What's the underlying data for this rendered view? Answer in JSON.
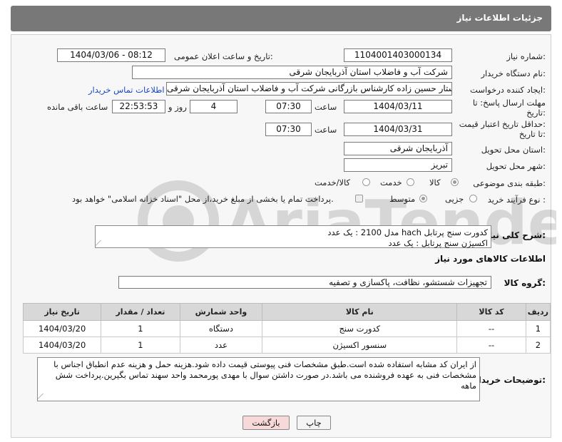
{
  "header": {
    "title": "جزئیات اطلاعات نیاز"
  },
  "fields": {
    "need_number_label": "شماره نیاز:",
    "need_number": "1104001403000134",
    "announce_label": "تاریخ و ساعت اعلان عمومی:",
    "announce_value": "1404/03/06 - 08:12",
    "buyer_org_label": "نام دستگاه خریدار:",
    "buyer_org": "شرکت آب و فاضلاب استان آذربایجان شرقی",
    "creator_label": "ایجاد کننده درخواست:",
    "creator": "ستار حسین زاده کارشناس بازرگانی شرکت آب و فاضلاب استان آذربایجان شرقی",
    "contact_link": "اطلاعات تماس خریدار",
    "deadline_label_1": "مهلت ارسال پاسخ: تا",
    "deadline_label_2": "تاریخ:",
    "deadline_date": "1404/03/11",
    "time_word": "ساعت",
    "deadline_time": "07:30",
    "days": "4",
    "days_word": "روز و",
    "remaining": "22:53:53",
    "remaining_word": "ساعت باقی مانده",
    "validity_label_1": "حداقل تاریخ اعتبار قیمت:",
    "validity_label_2": "تا تاریخ:",
    "validity_date": "1404/03/31",
    "validity_time": "07:30",
    "province_label": "استان محل تحویل:",
    "province": "آذربایجان شرقی",
    "city_label": "شهر محل تحویل:",
    "city": "تبریز",
    "category_label": "طبقه بندی موضوعی:",
    "cat_goods": "کالا",
    "cat_service": "خدمت",
    "cat_both": "کالا/خدمت",
    "process_label": "نوع فرآیند خرید :",
    "proc_minor": "جزیی",
    "proc_medium": "متوسط",
    "payment_note": "پرداخت تمام یا بخشی از مبلغ خرید،از محل \"اسناد خزانه اسلامی\" خواهد بود."
  },
  "description": {
    "label": "شرح کلی نیاز:",
    "line1": "کدورت سنج پرتابل hach مدل 2100 : یک عدد",
    "line2": "اکسیژن سنج پرتابل : یک عدد"
  },
  "goods_section": {
    "title": "اطلاعات کالاهای مورد نیاز"
  },
  "goods_group": {
    "label": "گروه کالا:",
    "value": "تجهیزات شستشو، نظافت، پاکسازی و تصفیه"
  },
  "table": {
    "headers": [
      "ردیف",
      "کد کالا",
      "نام کالا",
      "واحد شمارش",
      "تعداد / مقدار",
      "تاریخ نیاز"
    ],
    "rows": [
      [
        "1",
        "--",
        "کدورت سنج",
        "دستگاه",
        "1",
        "1404/03/20"
      ],
      [
        "2",
        "--",
        "سنسور اکسیژن",
        "عدد",
        "1",
        "1404/03/20"
      ]
    ]
  },
  "buyer_notes": {
    "label": "توضیحات خریدار:",
    "text": "از ایران کد مشابه استفاده شده است.طبق مشخصات فنی پیوستی قیمت داده شود.هزینه حمل و هزینه عدم انطباق اجناس با مشخصات فنی به عهده فروشنده می باشد.در صورت داشتن سوال با مهدی پورمحمد واحد سهند تماس بگیرین.پرداخت شش ماهه"
  },
  "buttons": {
    "print": "چاپ",
    "back": "بازگشت"
  },
  "watermark": {
    "text": "AriaTender.neT"
  },
  "colors": {
    "header_bg": "#787878",
    "link": "#1a48c4",
    "back_btn_bg": "#f7d9d9"
  }
}
